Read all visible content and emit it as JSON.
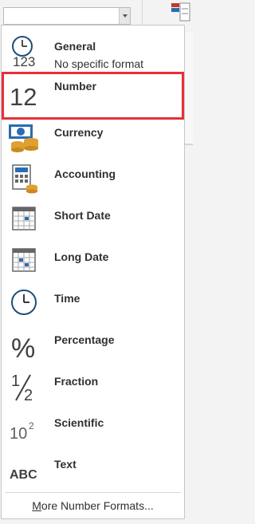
{
  "number_format": {
    "current_value": "",
    "menu_items": [
      {
        "name": "General",
        "desc": "No specific format",
        "icon": "clock-123-icon"
      },
      {
        "name": "Number",
        "icon": "number-12-icon",
        "selected": true
      },
      {
        "name": "Currency",
        "icon": "currency-banknote-coins-icon"
      },
      {
        "name": "Accounting",
        "icon": "calculator-ledger-icon"
      },
      {
        "name": "Short Date",
        "icon": "calendar-short-icon"
      },
      {
        "name": "Long Date",
        "icon": "calendar-long-icon"
      },
      {
        "name": "Time",
        "icon": "clock-icon"
      },
      {
        "name": "Percentage",
        "icon": "percent-icon"
      },
      {
        "name": "Fraction",
        "icon": "fraction-half-icon"
      },
      {
        "name": "Scientific",
        "icon": "scientific-10-squared-icon"
      },
      {
        "name": "Text",
        "icon": "abc-icon"
      }
    ],
    "more_link": {
      "prefix": "",
      "mnemonic": "M",
      "rest": "ore Number Formats..."
    }
  },
  "icon_text": {
    "general_digits": "123",
    "number_digits": "12",
    "fraction_top": "1",
    "fraction_bottom": "2",
    "sci_base": "10",
    "sci_exp": "2",
    "text_abc": "ABC",
    "percent": "%"
  },
  "colors": {
    "selected_outline": "#e8303a",
    "currency_green": "#2e7d32",
    "coin_gold": "#e0a030",
    "calendar_blue": "#2b6cb0"
  }
}
